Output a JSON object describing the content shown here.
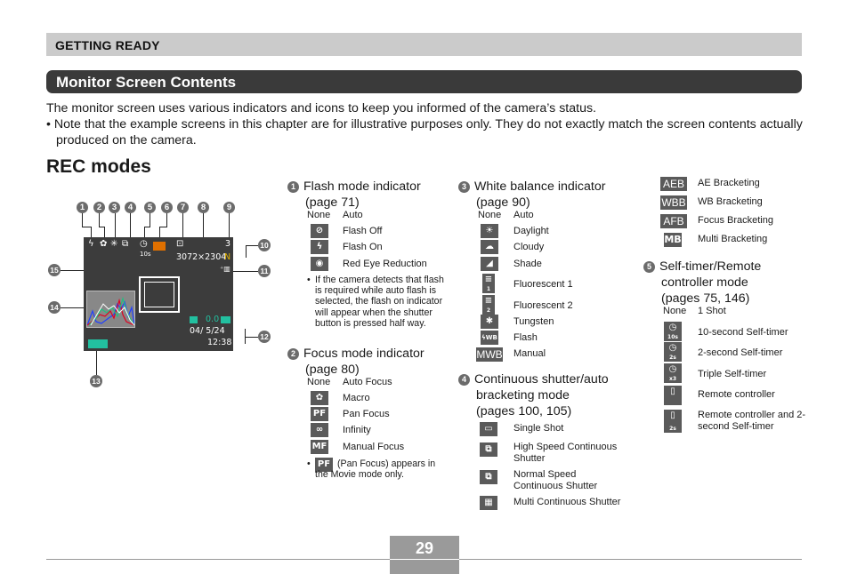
{
  "header": {
    "section": "GETTING READY",
    "title": "Monitor Screen Contents"
  },
  "intro": {
    "line1": "The monitor screen uses various indicators and icons to keep you informed of the camera’s status.",
    "note": "• Note that the example screens in this chapter are for illustrative purposes only. They do not exactly match the screen contents actually produced on the camera."
  },
  "rec_heading": "REC modes",
  "screen": {
    "callouts": [
      "1",
      "2",
      "3",
      "4",
      "5",
      "6",
      "7",
      "8",
      "9",
      "10",
      "11",
      "12",
      "13",
      "14",
      "15"
    ],
    "timer_label": "10s",
    "shots_remaining": "3",
    "resolution": "3072×2304",
    "quality": "N",
    "ev_value": "0.0",
    "date": "04/ 5/24",
    "time": "12:38",
    "colors": {
      "quality": "#e0b000",
      "ev": "#22c0a0",
      "battery": "#22c0a0",
      "card": "#e07000"
    }
  },
  "flash": {
    "number": "1",
    "title": "Flash mode indicator",
    "page": "(page 71)",
    "none_label": "None",
    "none_value": "Auto",
    "items": [
      {
        "icon": "flash-off-icon",
        "glyph": "⊘",
        "label": "Flash Off"
      },
      {
        "icon": "flash-on-icon",
        "glyph": "ϟ",
        "label": "Flash On"
      },
      {
        "icon": "red-eye-icon",
        "glyph": "◉",
        "label": "Red Eye Reduction"
      }
    ],
    "note": "If the camera detects that flash is required while auto flash is selected, the flash on indicator will appear when the shutter button is pressed half way."
  },
  "focus": {
    "number": "2",
    "title": "Focus mode indicator",
    "page": "(page 80)",
    "none_label": "None",
    "none_value": "Auto Focus",
    "items": [
      {
        "icon": "macro-icon",
        "glyph": "✿",
        "label": "Macro"
      },
      {
        "icon": "pan-focus-icon",
        "glyph": "PF",
        "label": "Pan Focus"
      },
      {
        "icon": "infinity-icon",
        "glyph": "∞",
        "label": "Infinity"
      },
      {
        "icon": "manual-focus-icon",
        "glyph": "MF",
        "label": "Manual Focus"
      }
    ],
    "note_icon": "PF",
    "note": "(Pan Focus) appears in the Movie mode only."
  },
  "white_balance": {
    "number": "3",
    "title": "White balance indicator",
    "page": "(page 90)",
    "none_label": "None",
    "none_value": "Auto",
    "items": [
      {
        "icon": "daylight-icon",
        "glyph": "☀",
        "label": "Daylight"
      },
      {
        "icon": "cloudy-icon",
        "glyph": "☁",
        "label": "Cloudy"
      },
      {
        "icon": "shade-icon",
        "glyph": "◢",
        "label": "Shade"
      },
      {
        "icon": "fluorescent-1-icon",
        "glyph": "≡",
        "sub": "1",
        "label": "Fluorescent 1"
      },
      {
        "icon": "fluorescent-2-icon",
        "glyph": "≡",
        "sub": "2",
        "label": "Fluorescent 2"
      },
      {
        "icon": "tungsten-icon",
        "glyph": "✱",
        "label": "Tungsten"
      },
      {
        "icon": "flash-wb-icon",
        "glyph": "ϟWB",
        "label": "Flash"
      },
      {
        "icon": "manual-wb-icon",
        "glyph": "MWB",
        "label": "Manual"
      }
    ]
  },
  "continuous": {
    "number": "4",
    "title_lines": [
      "Continuous shutter/auto",
      "bracketing mode",
      "(pages 100, 105)"
    ],
    "items": [
      {
        "icon": "single-shot-icon",
        "glyph": "▭",
        "label": "Single Shot"
      },
      {
        "icon": "high-speed-continuous-icon",
        "glyph": "⧉",
        "label": "High Speed Continuous Shutter"
      },
      {
        "icon": "normal-continuous-icon",
        "glyph": "⧉",
        "label": "Normal Speed Continuous Shutter"
      },
      {
        "icon": "multi-continuous-icon",
        "glyph": "▦",
        "label": "Multi Continuous Shutter"
      }
    ]
  },
  "bracketing": {
    "items": [
      {
        "icon": "ae-bracketing-icon",
        "glyph": "AEB",
        "label": "AE Bracketing"
      },
      {
        "icon": "wb-bracketing-icon",
        "glyph": "WBB",
        "label": "WB Bracketing"
      },
      {
        "icon": "focus-bracketing-icon",
        "glyph": "AFB",
        "label": "Focus Bracketing"
      },
      {
        "icon": "multi-bracketing-icon",
        "glyph": "MB",
        "label": "Multi Bracketing"
      }
    ]
  },
  "self_timer": {
    "number": "5",
    "title_lines": [
      "Self-timer/Remote",
      "controller mode",
      "(pages 75, 146)"
    ],
    "none_label": "None",
    "none_value": "1 Shot",
    "items": [
      {
        "icon": "timer-10s-icon",
        "glyph": "◷",
        "sub": "10s",
        "label": "10-second Self-timer"
      },
      {
        "icon": "timer-2s-icon",
        "glyph": "◷",
        "sub": "2s",
        "label": "2-second Self-timer"
      },
      {
        "icon": "timer-triple-icon",
        "glyph": "◷",
        "sub": "x3",
        "label": "Triple Self-timer"
      },
      {
        "icon": "remote-icon",
        "glyph": "▯",
        "sub": "",
        "label": "Remote controller"
      },
      {
        "icon": "remote-2s-icon",
        "glyph": "▯",
        "sub": "2s",
        "label": "Remote controller and 2-second Self-timer"
      }
    ]
  },
  "footer": {
    "page_number": "29"
  }
}
